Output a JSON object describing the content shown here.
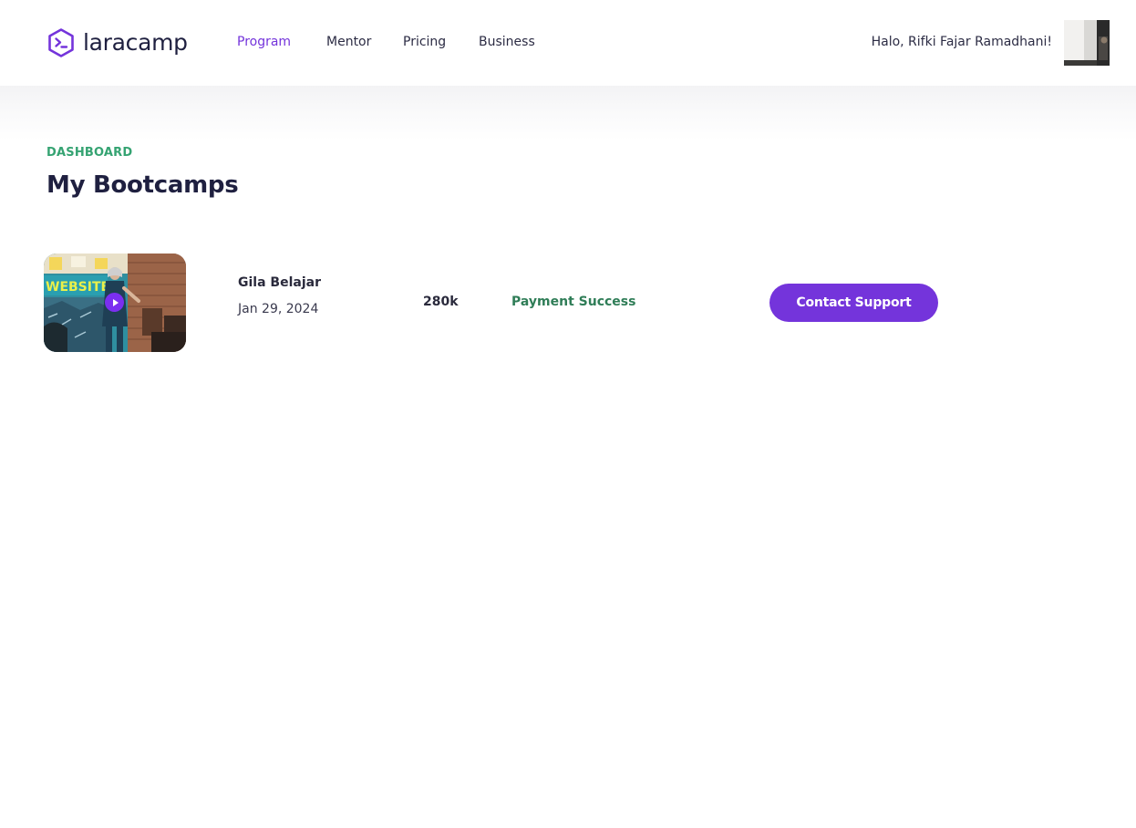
{
  "brand": {
    "name": "laracamp",
    "logo_icon": "hexagon-terminal-icon",
    "accent_color": "#7434DB"
  },
  "nav": {
    "items": [
      {
        "label": "Program",
        "active": true
      },
      {
        "label": "Mentor",
        "active": false
      },
      {
        "label": "Pricing",
        "active": false
      },
      {
        "label": "Business",
        "active": false
      }
    ]
  },
  "user": {
    "greeting": "Halo, Rifki Fajar Ramadhani!",
    "avatar_icon": "user-avatar-photo"
  },
  "header": {
    "eyebrow": "DASHBOARD",
    "title": "My Bootcamps"
  },
  "bootcamps": [
    {
      "thumbnail_icon": "bootcamp-thumbnail-photo",
      "play_icon": "play-icon",
      "name": "Gila Belajar",
      "date": "Jan 29, 2024",
      "price": "280k",
      "status": "Payment Success",
      "status_color": "#2F7D57",
      "action_label": "Contact Support"
    }
  ]
}
